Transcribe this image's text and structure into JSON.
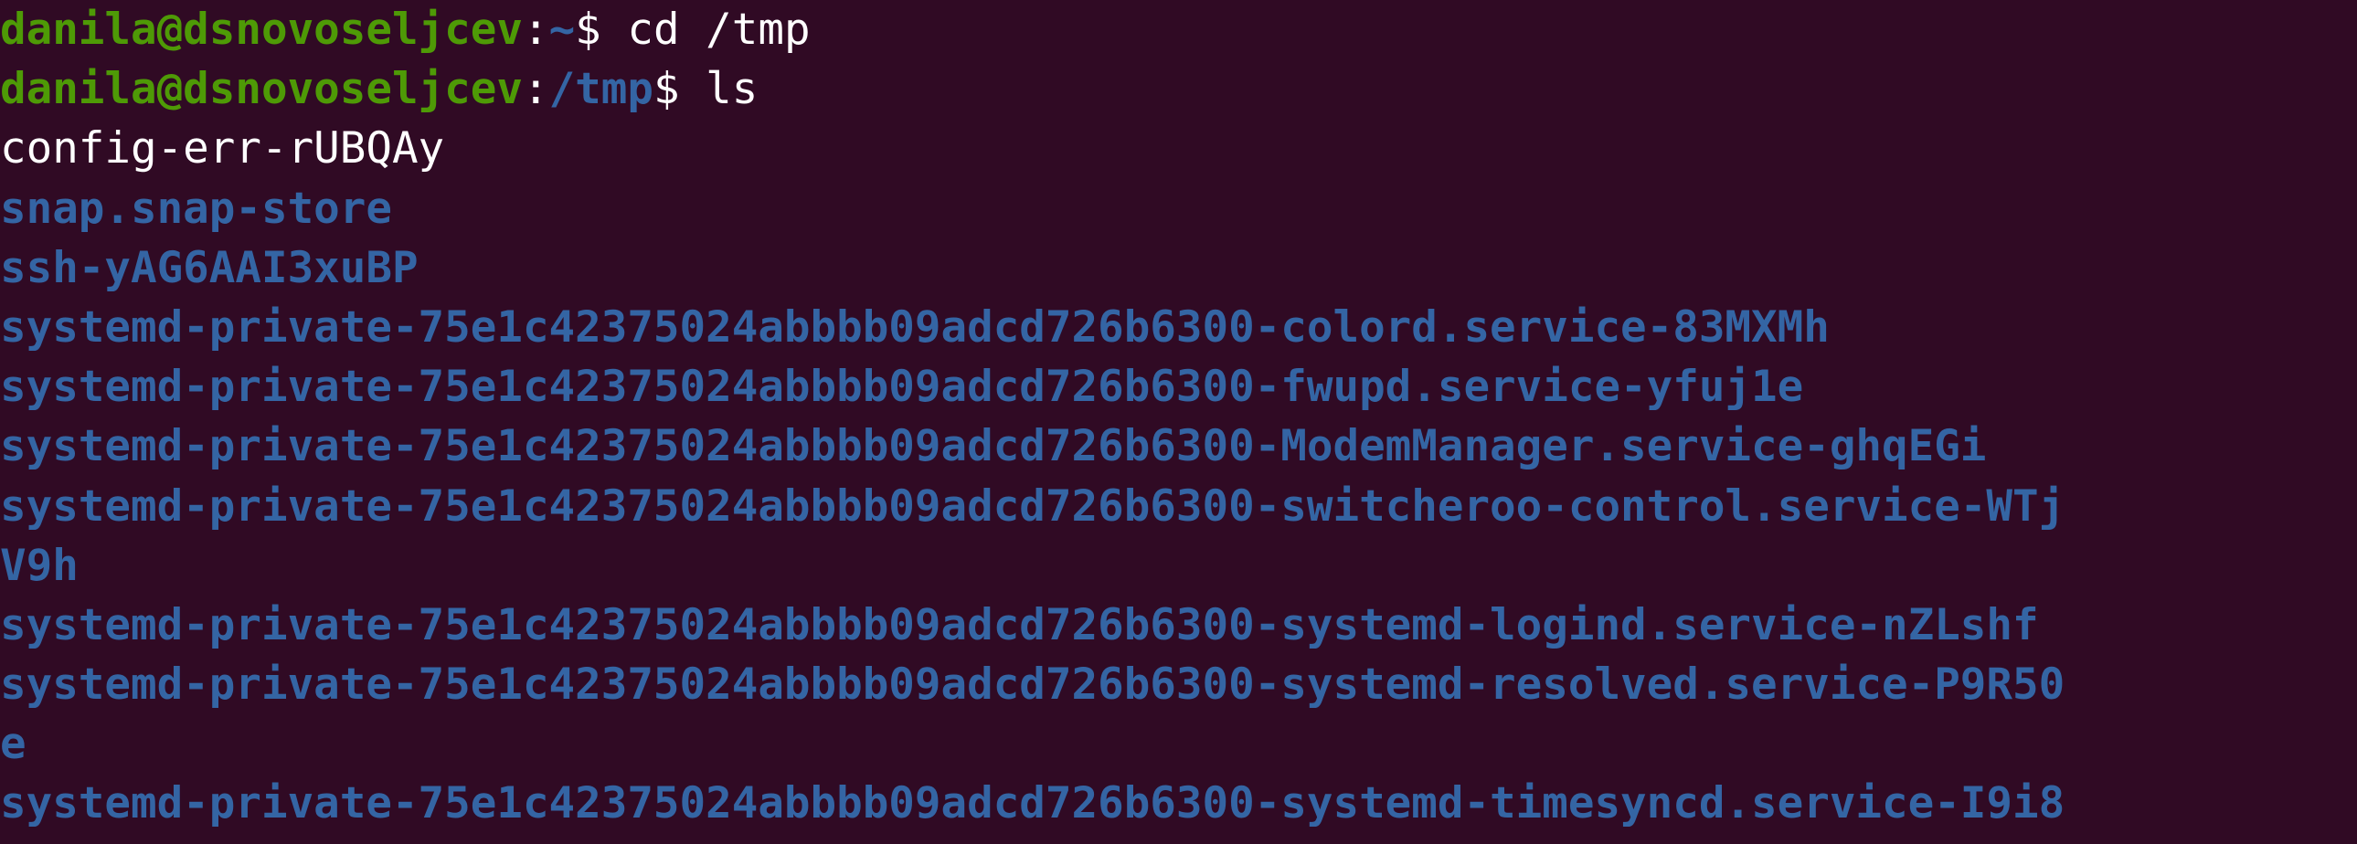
{
  "terminal": {
    "colors": {
      "background": "#300a24",
      "user_host": "#4e9a06",
      "path": "#3465a4",
      "text": "#ffffff",
      "directory": "#3465a4"
    },
    "prompt1": {
      "user_host": "danila@dsnovoseljcev",
      "colon": ":",
      "path": "~",
      "symbol": "$ ",
      "command": "cd /tmp"
    },
    "prompt2": {
      "user_host": "danila@dsnovoseljcev",
      "colon": ":",
      "path": "/tmp",
      "symbol": "$ ",
      "command": "ls"
    },
    "output": {
      "file_1": "config-err-rUBQAy",
      "dir_1": "snap.snap-store",
      "dir_2": "ssh-yAG6AAI3xuBP",
      "dir_3": "systemd-private-75e1c42375024abbbb09adcd726b6300-colord.service-83MXMh",
      "dir_4": "systemd-private-75e1c42375024abbbb09adcd726b6300-fwupd.service-yfuj1e",
      "dir_5": "systemd-private-75e1c42375024abbbb09adcd726b6300-ModemManager.service-ghqEGi",
      "dir_6_a": "systemd-private-75e1c42375024abbbb09adcd726b6300-switcheroo-control.service-WTj",
      "dir_6_b": "V9h",
      "dir_7": "systemd-private-75e1c42375024abbbb09adcd726b6300-systemd-logind.service-nZLshf",
      "dir_8_a": "systemd-private-75e1c42375024abbbb09adcd726b6300-systemd-resolved.service-P9R50",
      "dir_8_b": "e",
      "dir_9_a": "systemd-private-75e1c42375024abbbb09adcd726b6300-systemd-timesyncd.service-I9i8"
    }
  }
}
